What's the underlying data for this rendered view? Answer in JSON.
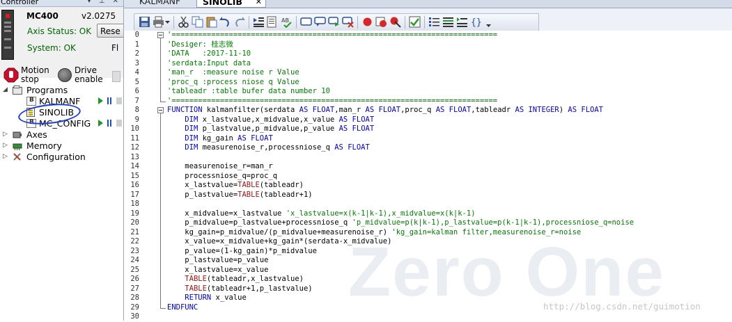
{
  "left_panel": {
    "title": "Controller",
    "title_controls": "▾ ⊥ ✕",
    "controller": {
      "model": "MC400",
      "version": "v2.0275",
      "axis_status": "Axis Status: OK",
      "reset_label": "Rese",
      "system_status": "System: OK",
      "fl_label": "Fl",
      "motion_stop_line1": "Motion",
      "motion_stop_line2": "stop",
      "drive_enable_line1": "Drive",
      "drive_enable_line2": "enable"
    },
    "tree": {
      "programs": "Programs",
      "items": [
        {
          "label": "KALMANF",
          "icon": "basic-file-icon"
        },
        {
          "label": "SINOLIB",
          "icon": "library-file-icon"
        },
        {
          "label": "MC_CONFIG",
          "icon": "basic-file-icon"
        }
      ],
      "axes": "Axes",
      "memory": "Memory",
      "configuration": "Configuration"
    }
  },
  "tabs": [
    {
      "label": "KALMANF",
      "active": false
    },
    {
      "label": "SINOLIB",
      "active": true,
      "close": "✕"
    }
  ],
  "toolbar": {
    "icons": [
      "save-icon",
      "print-icon",
      "dropdown-icon",
      "cut-icon",
      "copy-icon",
      "paste-icon",
      "undo-icon",
      "redo-icon",
      "indent-icon",
      "find-icon",
      "spellcheck-icon",
      "comment-icon",
      "bubble-icon",
      "goto-icon",
      "clear-bookmark-icon",
      "breakpoint-icon",
      "breakpoint-add-icon",
      "breakpoint-remove-icon",
      "check-icon",
      "align-icon",
      "list-icon",
      "outline-icon",
      "braces-icon"
    ]
  },
  "editor": {
    "lines": [
      {
        "n": "0",
        "t": "'==========================================================================",
        "k": "comment",
        "fold": "start"
      },
      {
        "n": "1",
        "t": "'Desiger: 桂志微",
        "k": "comment"
      },
      {
        "n": "2",
        "t": "'DATA   :2017-11-10",
        "k": "comment"
      },
      {
        "n": "3",
        "t": "'serdata:Input data",
        "k": "comment"
      },
      {
        "n": "4",
        "t": "'man_r  :measure noise r Value",
        "k": "comment"
      },
      {
        "n": "5",
        "t": "'proc_q :process niose q Value",
        "k": "comment"
      },
      {
        "n": "6",
        "t": "'tableadr :table bufer data number 10",
        "k": "comment"
      },
      {
        "n": "7",
        "t": "'==========================================================================",
        "k": "comment",
        "fold": "end"
      },
      {
        "n": "8",
        "t": "FUNCTION kalmanfilter(serdata AS FLOAT,man_r AS FLOAT,proc_q AS FLOAT,tableadr AS INTEGER) AS FLOAT",
        "k": "kw",
        "fold": "start"
      },
      {
        "n": "9",
        "t": "    DIM x_lastvalue,x_midvalue,x_value AS FLOAT",
        "k": "kw"
      },
      {
        "n": "10",
        "t": "    DIM p_lastvalue,p_midvalue,p_value AS FLOAT",
        "k": "kw"
      },
      {
        "n": "11",
        "t": "    DIM kg_gain AS FLOAT",
        "k": "kw"
      },
      {
        "n": "12",
        "t": "    DIM measurenoise_r,processniose_q AS FLOAT",
        "k": "kw"
      },
      {
        "n": "13",
        "t": "",
        "k": "plain"
      },
      {
        "n": "14",
        "t": "    measurenoise_r=man_r",
        "k": "plain"
      },
      {
        "n": "15",
        "t": "    processniose_q=proc_q",
        "k": "plain"
      },
      {
        "n": "16",
        "t": "    x_lastvalue=TABLE(tableadr)",
        "k": "plain"
      },
      {
        "n": "17",
        "t": "    p_lastvalue=TABLE(tableadr+1)",
        "k": "plain"
      },
      {
        "n": "18",
        "t": "",
        "k": "plain"
      },
      {
        "n": "19",
        "t": "    x_midvalue=x_lastvalue 'x_lastvalue=x(k-1|k-1),x_midvalue=x(k|k-1)",
        "k": "mixed"
      },
      {
        "n": "20",
        "t": "    p_midvalue=p_lastvalue+processniose_q 'p_midvalue=p(k|k-1),p_lastvalue=p(k-1|k-1),processniose_q=noise",
        "k": "mixed"
      },
      {
        "n": "21",
        "t": "    kg_gain=p_midvalue/(p_midvalue+measurenoise_r) 'kg_gain=kalman filter,measurenoise_r=noise",
        "k": "mixed"
      },
      {
        "n": "22",
        "t": "    x_value=x_midvalue+kg_gain*(serdata-x_midvalue)",
        "k": "plain"
      },
      {
        "n": "23",
        "t": "    p_value=(1-kg_gain)*p_midvalue",
        "k": "plain"
      },
      {
        "n": "24",
        "t": "    p_lastvalue=p_value",
        "k": "plain"
      },
      {
        "n": "25",
        "t": "    x_lastvalue=x_value",
        "k": "plain"
      },
      {
        "n": "26",
        "t": "    TABLE(tableadr,x_lastvalue)",
        "k": "plain"
      },
      {
        "n": "27",
        "t": "    TABLE(tableadr+1,p_lastvalue)",
        "k": "plain"
      },
      {
        "n": "28",
        "t": "    RETURN x_value",
        "k": "kw"
      },
      {
        "n": "29",
        "t": "ENDFUNC",
        "k": "kw",
        "fold": "end"
      },
      {
        "n": "30",
        "t": "",
        "k": "plain"
      }
    ]
  },
  "watermark": {
    "text": "Zero One",
    "url": "http://blog.csdn.net/guimotion"
  },
  "colors": {
    "comment": "#008000",
    "keyword": "#0000cc",
    "annotation_circle": "#1f3fd8"
  }
}
